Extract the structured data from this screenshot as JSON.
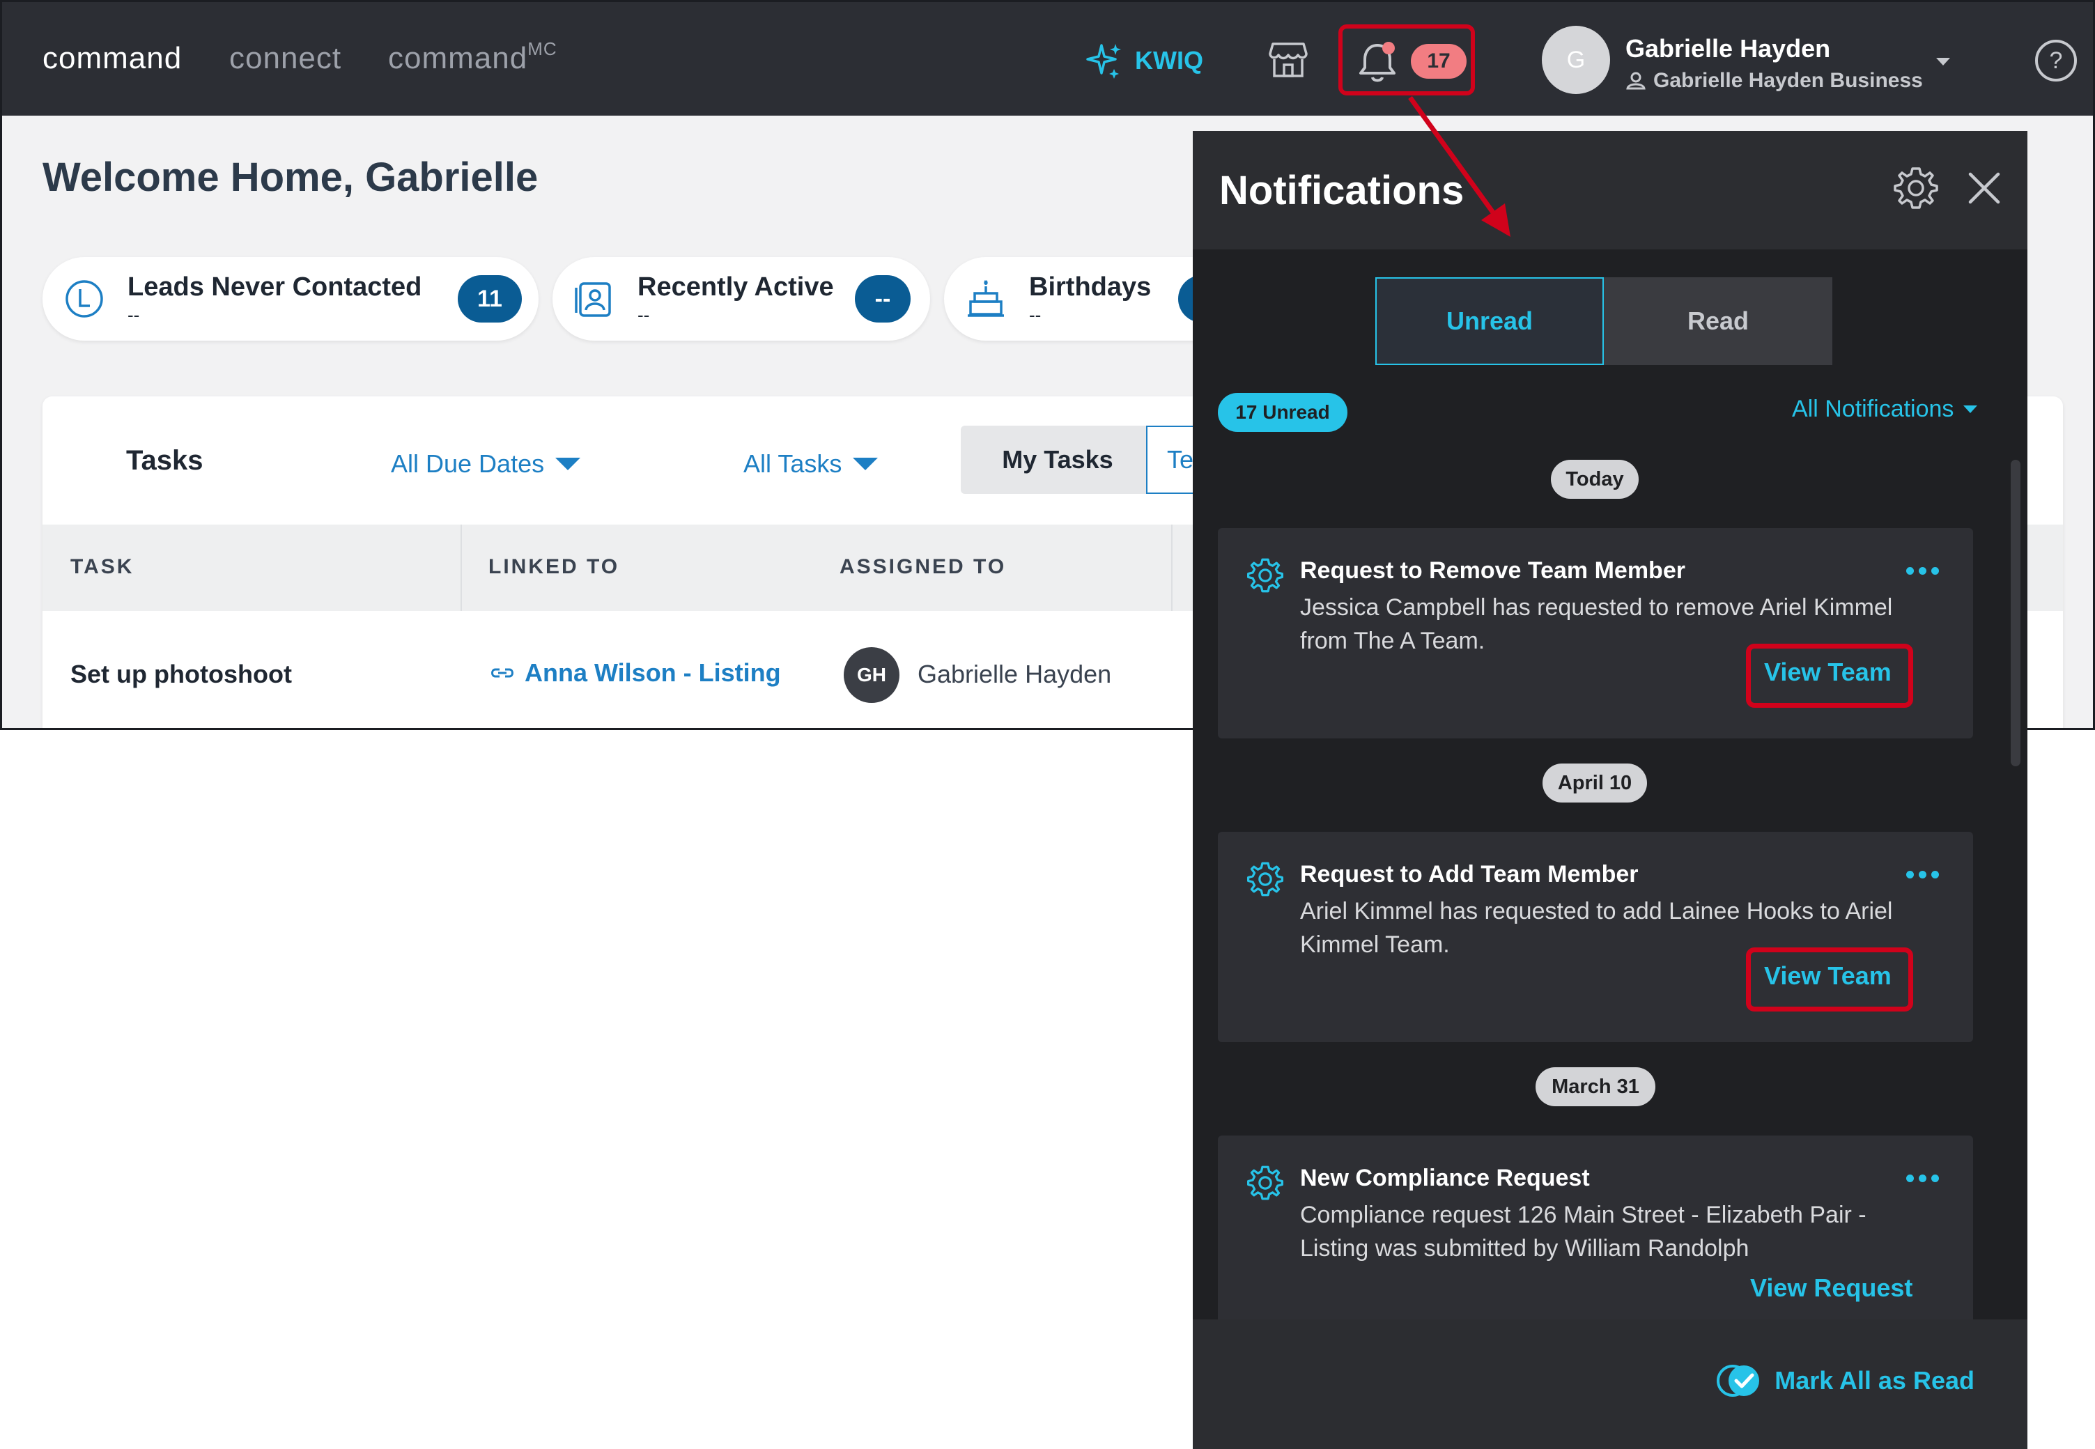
{
  "topbar": {
    "brands": [
      "command",
      "connect",
      "command"
    ],
    "brand_sup": "MC",
    "kwiq_label": "KWIQ",
    "notification_count": "17",
    "avatar_initial": "G",
    "user_name": "Gabrielle Hayden",
    "user_business": "Gabrielle Hayden Business",
    "help_label": "?"
  },
  "home": {
    "welcome": "Welcome Home, Gabrielle",
    "stats": [
      {
        "label": "Leads Never Contacted",
        "sub": "--",
        "count": "11"
      },
      {
        "label": "Recently Active",
        "sub": "--",
        "count": "--"
      },
      {
        "label": "Birthdays",
        "sub": "--",
        "count": ""
      }
    ]
  },
  "tasks": {
    "title": "Tasks",
    "filter_due": "All Due Dates",
    "filter_tasks": "All Tasks",
    "tab_my": "My Tasks",
    "tab_team": "Te",
    "columns": [
      "TASK",
      "LINKED TO",
      "ASSIGNED TO"
    ],
    "rows": [
      {
        "task": "Set up photoshoot",
        "linked": "Anna Wilson - Listing",
        "initials": "GH",
        "assignee": "Gabrielle Hayden"
      }
    ]
  },
  "notifications": {
    "title": "Notifications",
    "tab_unread": "Unread",
    "tab_read": "Read",
    "unread_pill": "17 Unread",
    "filter_label": "All Notifications",
    "groups": [
      {
        "date": "Today",
        "title": "Request to Remove Team Member",
        "body": "Jessica Campbell has requested to remove Ariel Kimmel from The A Team.",
        "action": "View Team"
      },
      {
        "date": "April 10",
        "title": "Request to Add Team Member",
        "body": "Ariel Kimmel has requested to add Lainee Hooks to Ariel Kimmel Team.",
        "action": "View Team"
      },
      {
        "date": "March 31",
        "title": "New Compliance Request",
        "body": "Compliance request 126 Main Street - Elizabeth Pair - Listing was submitted by William Randolph",
        "action": "View Request"
      }
    ],
    "mark_all": "Mark All as Read"
  },
  "colors": {
    "accent": "#27c3e8",
    "highlight": "#d0021b",
    "topbar": "#2c2e34",
    "drawer": "#1f2023",
    "badge": "#f27d82",
    "stat_badge": "#0a5c94"
  },
  "icons": [
    "sparkle-icon",
    "store-icon",
    "bell-icon",
    "business-icon",
    "caret-down-icon",
    "help-icon",
    "clock-icon",
    "contact-card-icon",
    "cake-icon",
    "link-icon",
    "gear-icon",
    "close-icon",
    "more-icon",
    "check-circle-icon"
  ]
}
